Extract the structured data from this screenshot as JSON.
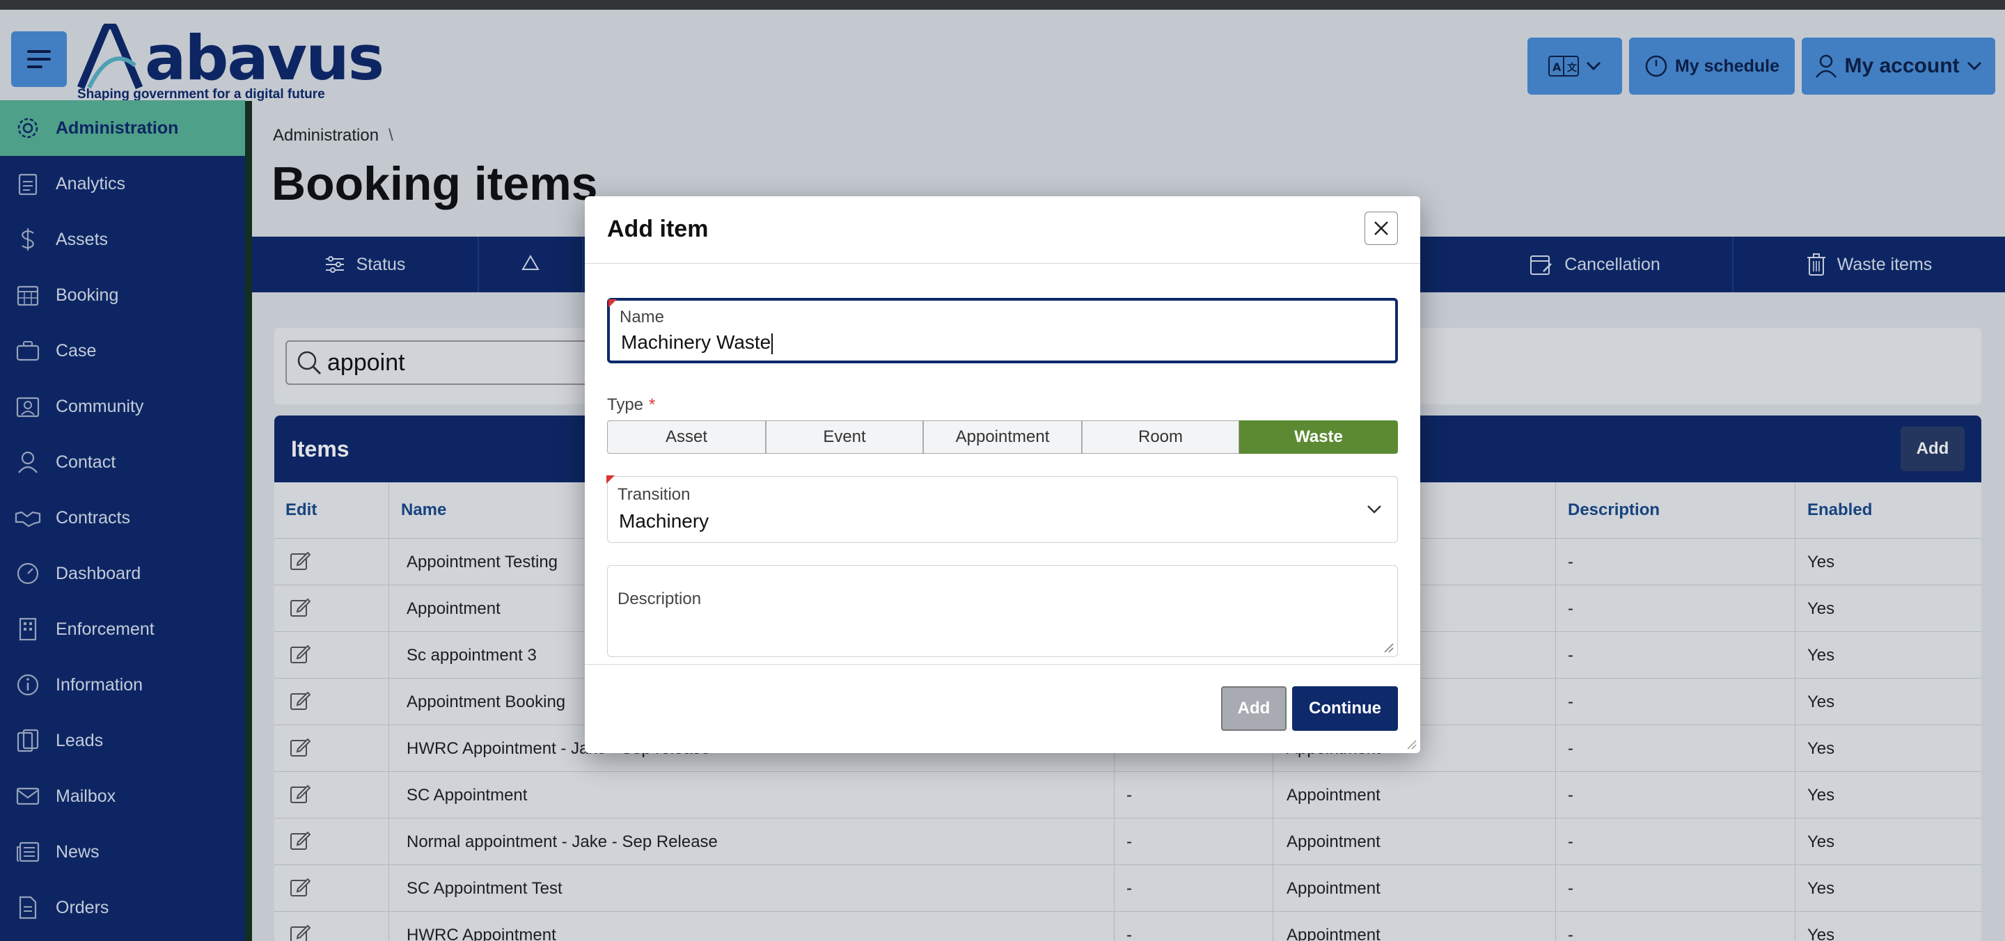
{
  "header": {
    "logo_word": "abavus",
    "logo_tagline": "Shaping government for a digital future",
    "schedule_label": "My schedule",
    "account_label": "My account"
  },
  "sidebar": {
    "items": [
      {
        "label": "Administration",
        "icon": "gear-icon"
      },
      {
        "label": "Analytics",
        "icon": "clipboard-icon"
      },
      {
        "label": "Assets",
        "icon": "dollar-icon"
      },
      {
        "label": "Booking",
        "icon": "calendar-icon"
      },
      {
        "label": "Case",
        "icon": "briefcase-icon"
      },
      {
        "label": "Community",
        "icon": "community-icon"
      },
      {
        "label": "Contact",
        "icon": "person-icon"
      },
      {
        "label": "Contracts",
        "icon": "handshake-icon"
      },
      {
        "label": "Dashboard",
        "icon": "dashboard-icon"
      },
      {
        "label": "Enforcement",
        "icon": "building-icon"
      },
      {
        "label": "Information",
        "icon": "info-icon"
      },
      {
        "label": "Leads",
        "icon": "leads-icon"
      },
      {
        "label": "Mailbox",
        "icon": "envelope-icon"
      },
      {
        "label": "News",
        "icon": "newspaper-icon"
      },
      {
        "label": "Orders",
        "icon": "document-icon"
      }
    ]
  },
  "main": {
    "breadcrumb": "Administration",
    "breadcrumb_sep": "\\",
    "title": "Booking items",
    "tabs": [
      "Status",
      "Cancellation",
      "Waste items"
    ],
    "search_value": "appoint",
    "items_title": "Items",
    "items_add": "Add",
    "columns": [
      "Edit",
      "Name",
      "Description",
      "Enabled"
    ],
    "rows": [
      {
        "name": "Appointment Testing",
        "col3": "",
        "col4": "",
        "desc": "-",
        "enabled": "Yes"
      },
      {
        "name": "Appointment",
        "col3": "",
        "col4": "",
        "desc": "-",
        "enabled": "Yes"
      },
      {
        "name": "Sc appointment 3",
        "col3": "",
        "col4": "",
        "desc": "-",
        "enabled": "Yes"
      },
      {
        "name": "Appointment Booking",
        "col3": "",
        "col4": "",
        "desc": "-",
        "enabled": "Yes"
      },
      {
        "name": "HWRC Appointment - Jake - Sep release",
        "col3": "",
        "col4": "Appointment",
        "desc": "-",
        "enabled": "Yes"
      },
      {
        "name": "SC Appointment",
        "col3": "-",
        "col4": "Appointment",
        "desc": "-",
        "enabled": "Yes"
      },
      {
        "name": "Normal appointment - Jake - Sep Release",
        "col3": "-",
        "col4": "Appointment",
        "desc": "-",
        "enabled": "Yes"
      },
      {
        "name": "SC Appointment Test",
        "col3": "-",
        "col4": "Appointment",
        "desc": "-",
        "enabled": "Yes"
      },
      {
        "name": "HWRC Appointment",
        "col3": "-",
        "col4": "Appointment",
        "desc": "-",
        "enabled": "Yes"
      }
    ]
  },
  "modal": {
    "title": "Add item",
    "name_label": "Name",
    "name_value": "Machinery Waste",
    "type_label": "Type",
    "type_required": "*",
    "type_options": [
      "Asset",
      "Event",
      "Appointment",
      "Room",
      "Waste"
    ],
    "type_selected": "Waste",
    "transition_label": "Transition",
    "transition_value": "Machinery",
    "description_label": "Description",
    "add_label": "Add",
    "continue_label": "Continue"
  },
  "colors": {
    "navy": "#0e2a6b",
    "accent_blue": "#4a8fd8",
    "active_green": "#59b496",
    "selected_green": "#5b8a32"
  }
}
